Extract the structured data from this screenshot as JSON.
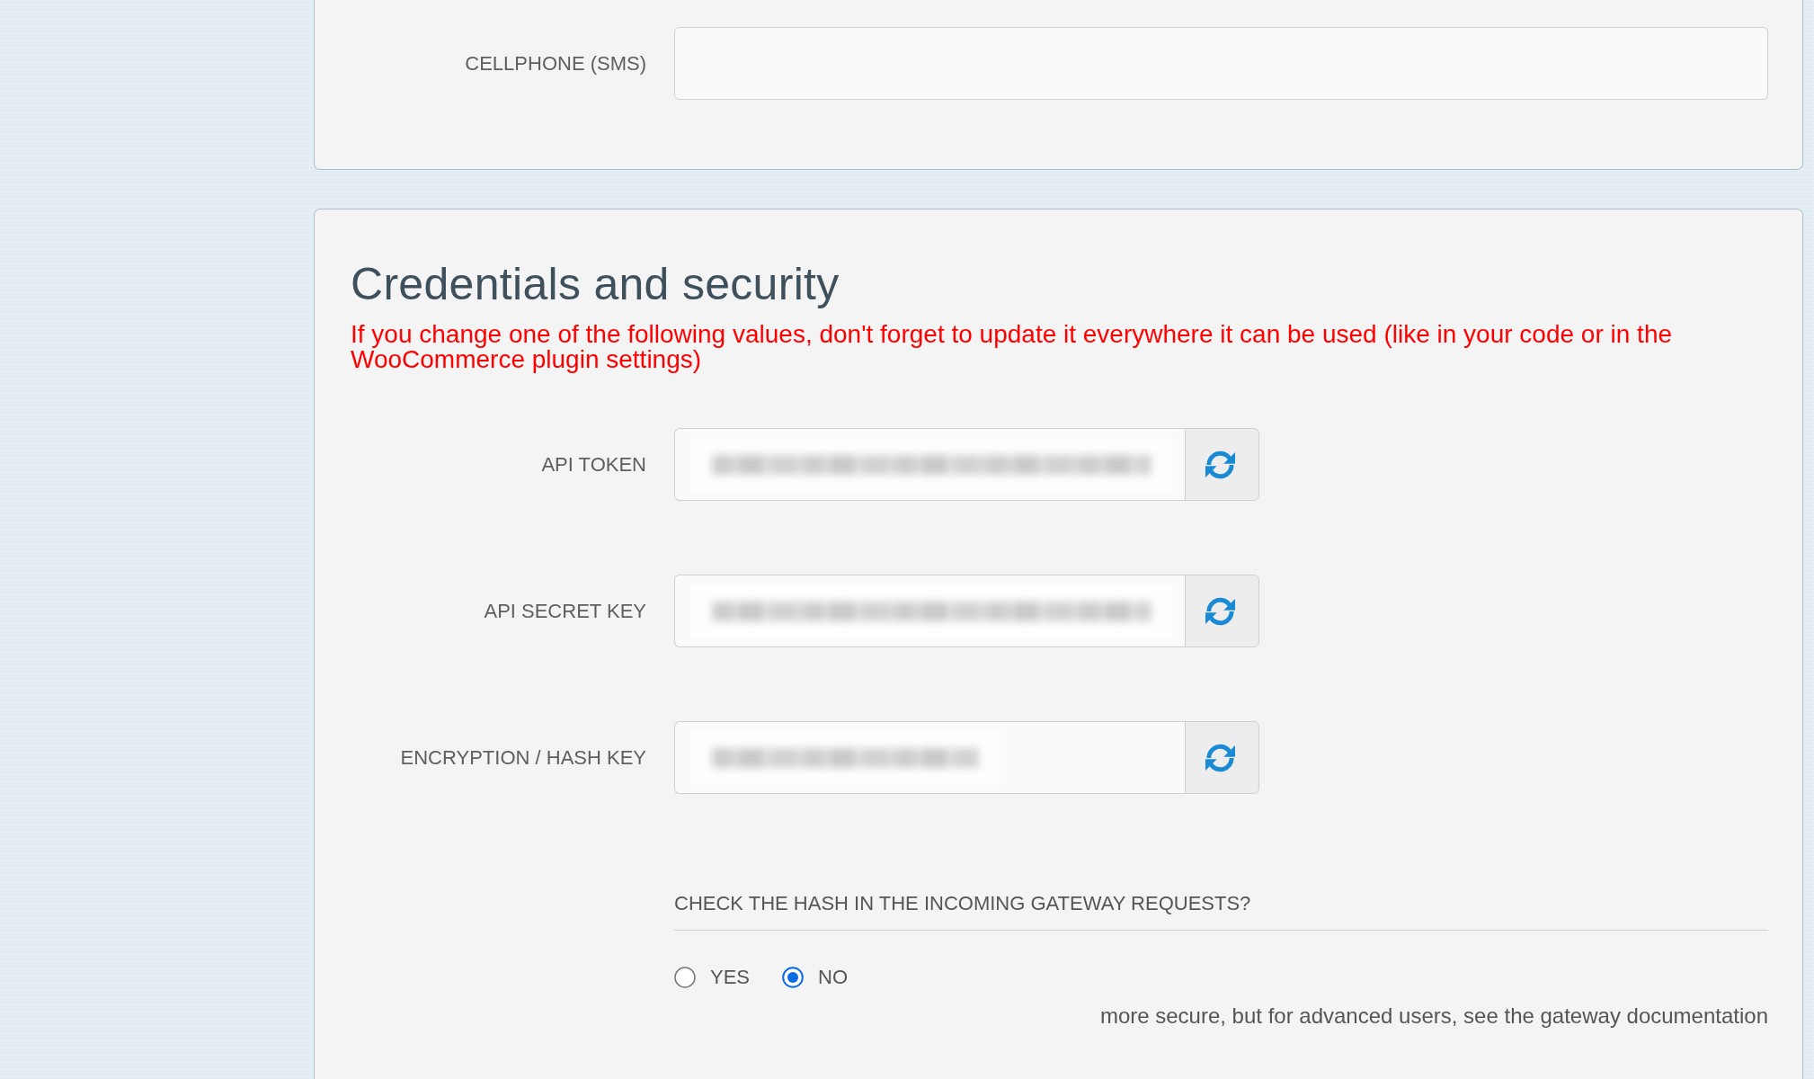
{
  "contact_section": {
    "fields": [
      {
        "label": "CELLPHONE (SMS)"
      }
    ]
  },
  "credentials_section": {
    "title": "Credentials and security",
    "warning": "If you change one of the following values, don't forget to update it everywhere it can be used (like in your code or in the WooCommerce plugin settings)",
    "fields": [
      {
        "label": "API TOKEN",
        "kind": "long"
      },
      {
        "label": "API SECRET KEY",
        "kind": "long"
      },
      {
        "label": "ENCRYPTION / HASH KEY",
        "kind": "short"
      }
    ],
    "hash_check": {
      "question": "CHECK THE HASH IN THE INCOMING GATEWAY REQUESTS?",
      "options": [
        {
          "label": "YES",
          "selected": false
        },
        {
          "label": "NO",
          "selected": true
        }
      ],
      "help": "more secure, but for advanced users, see the gateway documentation"
    }
  }
}
